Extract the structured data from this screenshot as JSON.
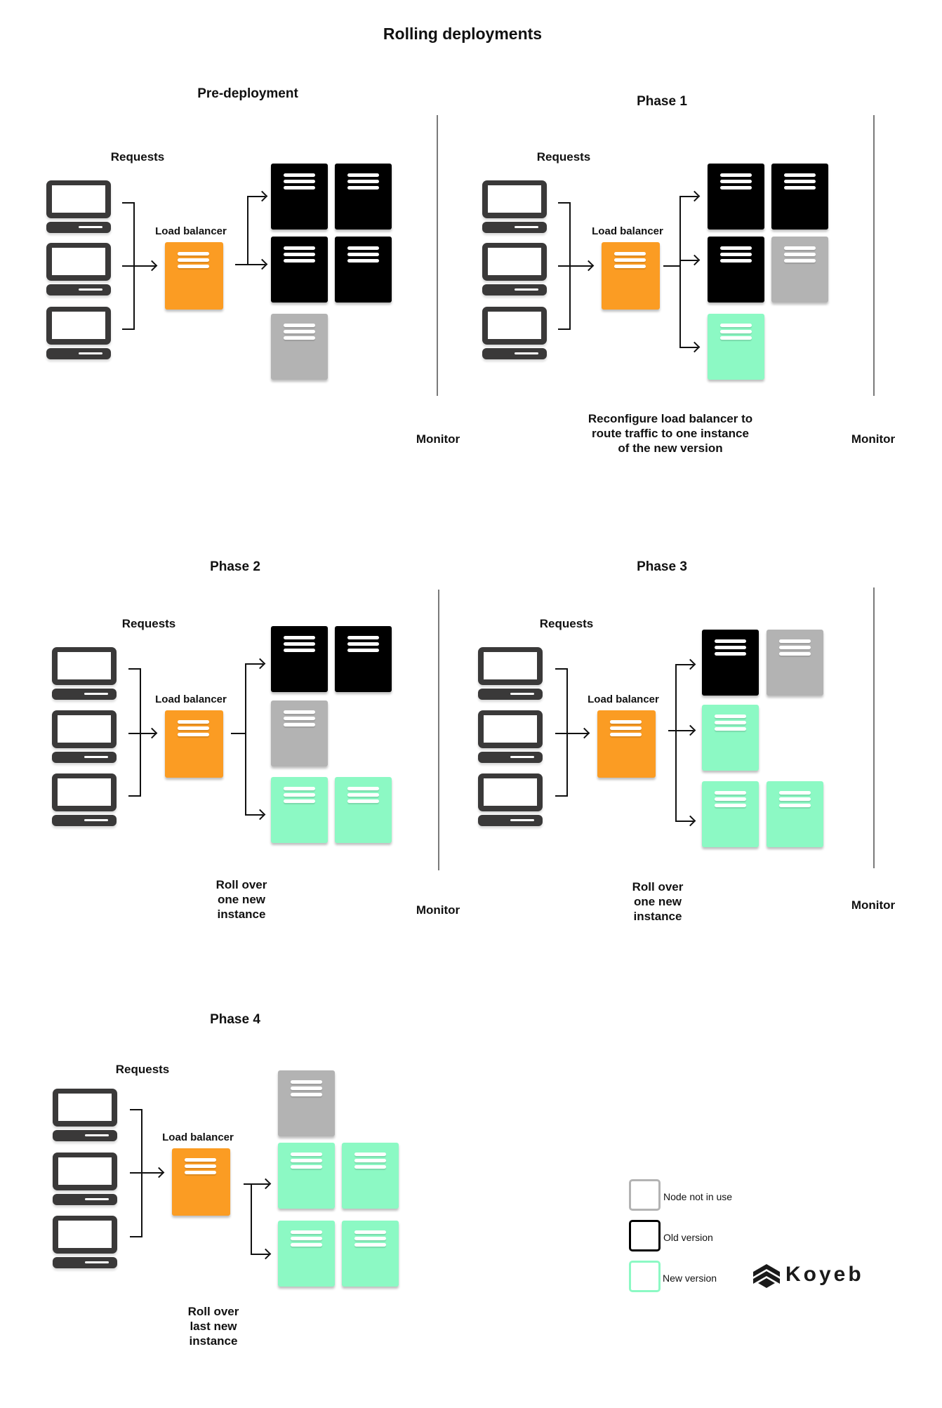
{
  "title": "Rolling deployments",
  "colors": {
    "old_version": "#000000",
    "node_not_in_use": "#b3b3b3",
    "new_version": "#8cf9c4",
    "load_balancer": "#fb9c23",
    "laptop": "#3a3939"
  },
  "panels": [
    {
      "heading": "Pre-deployment",
      "requests_label": "Requests",
      "load_balancer_label": "Load balancer",
      "servers": [
        "old",
        "old",
        "old",
        "old",
        "idle"
      ],
      "caption": "",
      "monitor_label": "Monitor"
    },
    {
      "heading": "Phase 1",
      "requests_label": "Requests",
      "load_balancer_label": "Load balancer",
      "servers": [
        "old",
        "old",
        "old",
        "idle",
        "new"
      ],
      "caption": "Reconfigure load balancer to\nroute traffic to one instance\nof the new version",
      "monitor_label": "Monitor"
    },
    {
      "heading": "Phase 2",
      "requests_label": "Requests",
      "load_balancer_label": "Load balancer",
      "servers": [
        "old",
        "old",
        "idle",
        "new",
        "new"
      ],
      "caption": "Roll over\none new\ninstance",
      "monitor_label": "Monitor"
    },
    {
      "heading": "Phase 3",
      "requests_label": "Requests",
      "load_balancer_label": "Load balancer",
      "servers": [
        "old",
        "idle",
        "new",
        "new",
        "new"
      ],
      "caption": "Roll over\none new\ninstance",
      "monitor_label": "Monitor"
    },
    {
      "heading": "Phase 4",
      "requests_label": "Requests",
      "load_balancer_label": "Load balancer",
      "servers": [
        "idle",
        "new",
        "new",
        "new",
        "new"
      ],
      "caption": "Roll over\nlast new\ninstance"
    }
  ],
  "legend": [
    {
      "label": "Node not in use",
      "color": "#b3b3b3"
    },
    {
      "label": "Old version",
      "color": "#000000"
    },
    {
      "label": "New version",
      "color": "#8cf9c4"
    }
  ],
  "logo": {
    "text": "Koyeb",
    "icon": "koyeb-logo-icon"
  }
}
